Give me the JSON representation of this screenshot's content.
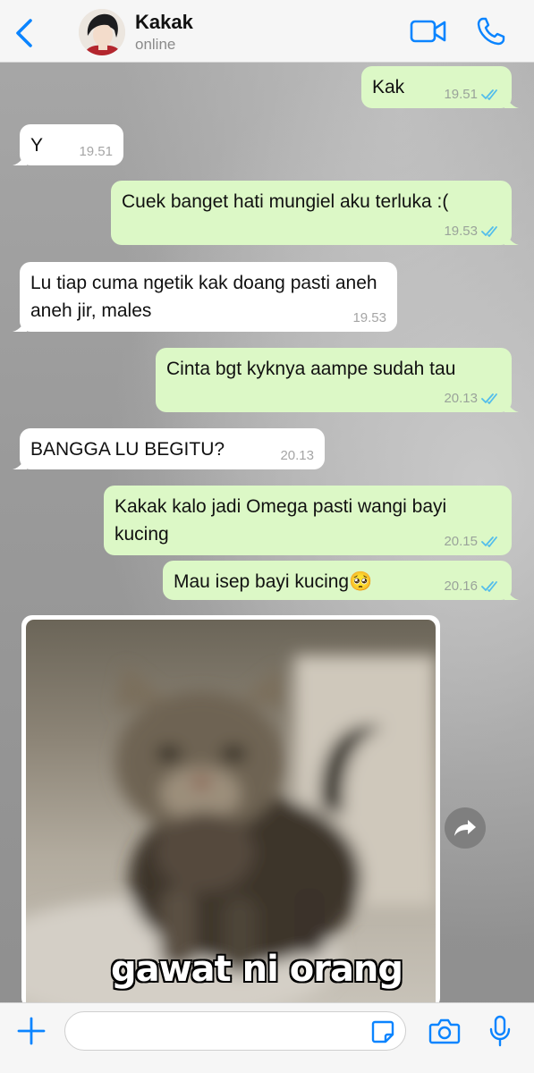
{
  "header": {
    "contact_name": "Kakak",
    "status": "online",
    "icons": [
      "back-chevron-icon",
      "avatar",
      "video-call-icon",
      "phone-call-icon"
    ]
  },
  "colors": {
    "accent": "#0a84ff",
    "outgoing_bubble": "#dcf8c6",
    "incoming_bubble": "#ffffff",
    "read_ticks": "#53bdeb"
  },
  "messages": [
    {
      "direction": "out",
      "text": "Kak",
      "time": "19.51",
      "read": true
    },
    {
      "direction": "in",
      "text": "Y",
      "time": "19.51"
    },
    {
      "direction": "out",
      "text": "Cuek banget hati mungiel aku terluka :(",
      "time": "19.53",
      "read": true
    },
    {
      "direction": "in",
      "text": "Lu tiap cuma ngetik kak doang pasti aneh aneh jir, males",
      "time": "19.53"
    },
    {
      "direction": "out",
      "text": "Cinta bgt kyknya aampe sudah tau",
      "time": "20.13",
      "read": true
    },
    {
      "direction": "in",
      "text": "BANGGA LU BEGITU?",
      "time": "20.13"
    },
    {
      "direction": "out",
      "text": "Kakak kalo jadi Omega pasti wangi bayi kucing",
      "time": "20.15",
      "read": true
    },
    {
      "direction": "out",
      "text": "Mau isep bayi kucing🥺",
      "time": "20.16",
      "read": true
    }
  ],
  "image_message": {
    "direction": "in",
    "caption": "gawat ni orang",
    "subject": "blurry tabby kitten meme"
  },
  "input_bar": {
    "placeholder": "",
    "icons": [
      "plus-icon",
      "sticker-icon",
      "camera-icon",
      "microphone-icon"
    ]
  }
}
